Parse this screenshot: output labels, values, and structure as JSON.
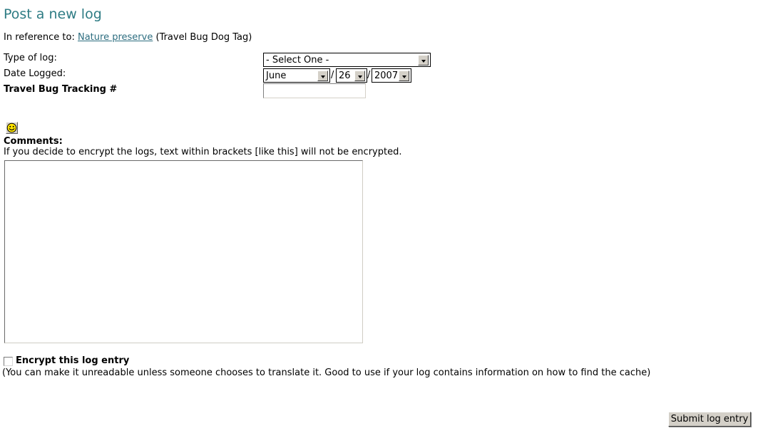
{
  "page": {
    "title": "Post a new log",
    "title_color": "#2E7C84",
    "background": "#ffffff"
  },
  "reference": {
    "prefix": "In reference to:",
    "link_text": "Nature preserve",
    "link_color": "#2E6E80",
    "suffix": "(Travel Bug Dog Tag)"
  },
  "form": {
    "type_of_log": {
      "label": "Type of log:",
      "selected": "- Select One -",
      "options": [
        "- Select One -"
      ]
    },
    "date_logged": {
      "label": "Date Logged:",
      "separator": "/",
      "month": {
        "selected": "June"
      },
      "day": {
        "selected": "26"
      },
      "year": {
        "selected": "2007"
      }
    },
    "tracking": {
      "label": "Travel Bug Tracking #",
      "value": "",
      "placeholder": ""
    },
    "comments": {
      "smiley_icon": "smiley-icon",
      "label": "Comments:",
      "help": "If you decide to encrypt the logs, text within brackets [like this] will not be encrypted.",
      "value": "",
      "placeholder": ""
    },
    "encrypt": {
      "label": "Encrypt this log entry",
      "checked": false,
      "help": "(You can make it unreadable unless someone chooses to translate it. Good to use if your log contains information on how to find the cache)"
    },
    "submit": {
      "label": "Submit log entry"
    }
  }
}
